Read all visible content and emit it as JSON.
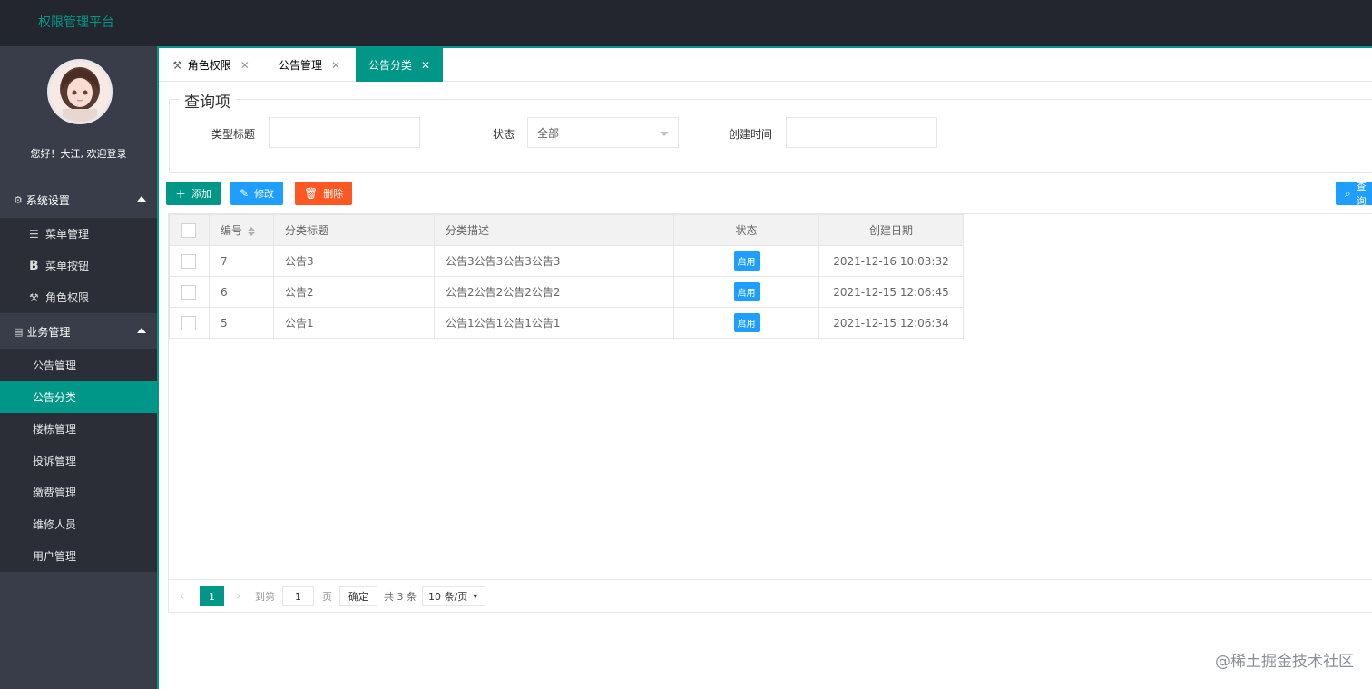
{
  "app": {
    "title": "权限管理平台"
  },
  "sidebar": {
    "welcome": "您好！大江, 欢迎登录",
    "groups": [
      {
        "label": "系统设置",
        "items": [
          {
            "label": "菜单管理"
          },
          {
            "label": "菜单按钮"
          },
          {
            "label": "角色权限"
          }
        ]
      },
      {
        "label": "业务管理",
        "items": [
          {
            "label": "公告管理"
          },
          {
            "label": "公告分类"
          },
          {
            "label": "楼栋管理"
          },
          {
            "label": "投诉管理"
          },
          {
            "label": "缴费管理"
          },
          {
            "label": "维修人员"
          },
          {
            "label": "用户管理"
          }
        ]
      }
    ],
    "active_item": "公告分类"
  },
  "tabs": [
    {
      "label": "角色权限"
    },
    {
      "label": "公告管理"
    },
    {
      "label": "公告分类"
    }
  ],
  "query": {
    "legend": "查询项",
    "title_label": "类型标题",
    "title_value": "",
    "status_label": "状态",
    "status_value": "全部",
    "created_label": "创建时间",
    "created_value": ""
  },
  "toolbar": {
    "add": "添加",
    "edit": "修改",
    "delete": "删除",
    "search": "查询"
  },
  "table": {
    "headers": [
      "编号",
      "分类标题",
      "分类描述",
      "状态",
      "创建日期"
    ],
    "rows": [
      {
        "id": "7",
        "title": "公告3",
        "desc": "公告3公告3公告3公告3",
        "status": "启用",
        "created": "2021-12-16 10:03:32"
      },
      {
        "id": "6",
        "title": "公告2",
        "desc": "公告2公告2公告2公告2",
        "status": "启用",
        "created": "2021-12-15 12:06:45"
      },
      {
        "id": "5",
        "title": "公告1",
        "desc": "公告1公告1公告1公告1",
        "status": "启用",
        "created": "2021-12-15 12:06:34"
      }
    ]
  },
  "pager": {
    "current": "1",
    "goto_label": "到第",
    "goto_value": "1",
    "page_unit": "页",
    "confirm": "确定",
    "total": "共 3 条",
    "page_size": "10 条/页"
  },
  "watermark": "@稀土掘金技术社区",
  "colors": {
    "accent": "#009688",
    "topbar": "#23262e",
    "sidebar": "#393d49",
    "blue": "#1e9fff",
    "orange": "#ff5722"
  }
}
